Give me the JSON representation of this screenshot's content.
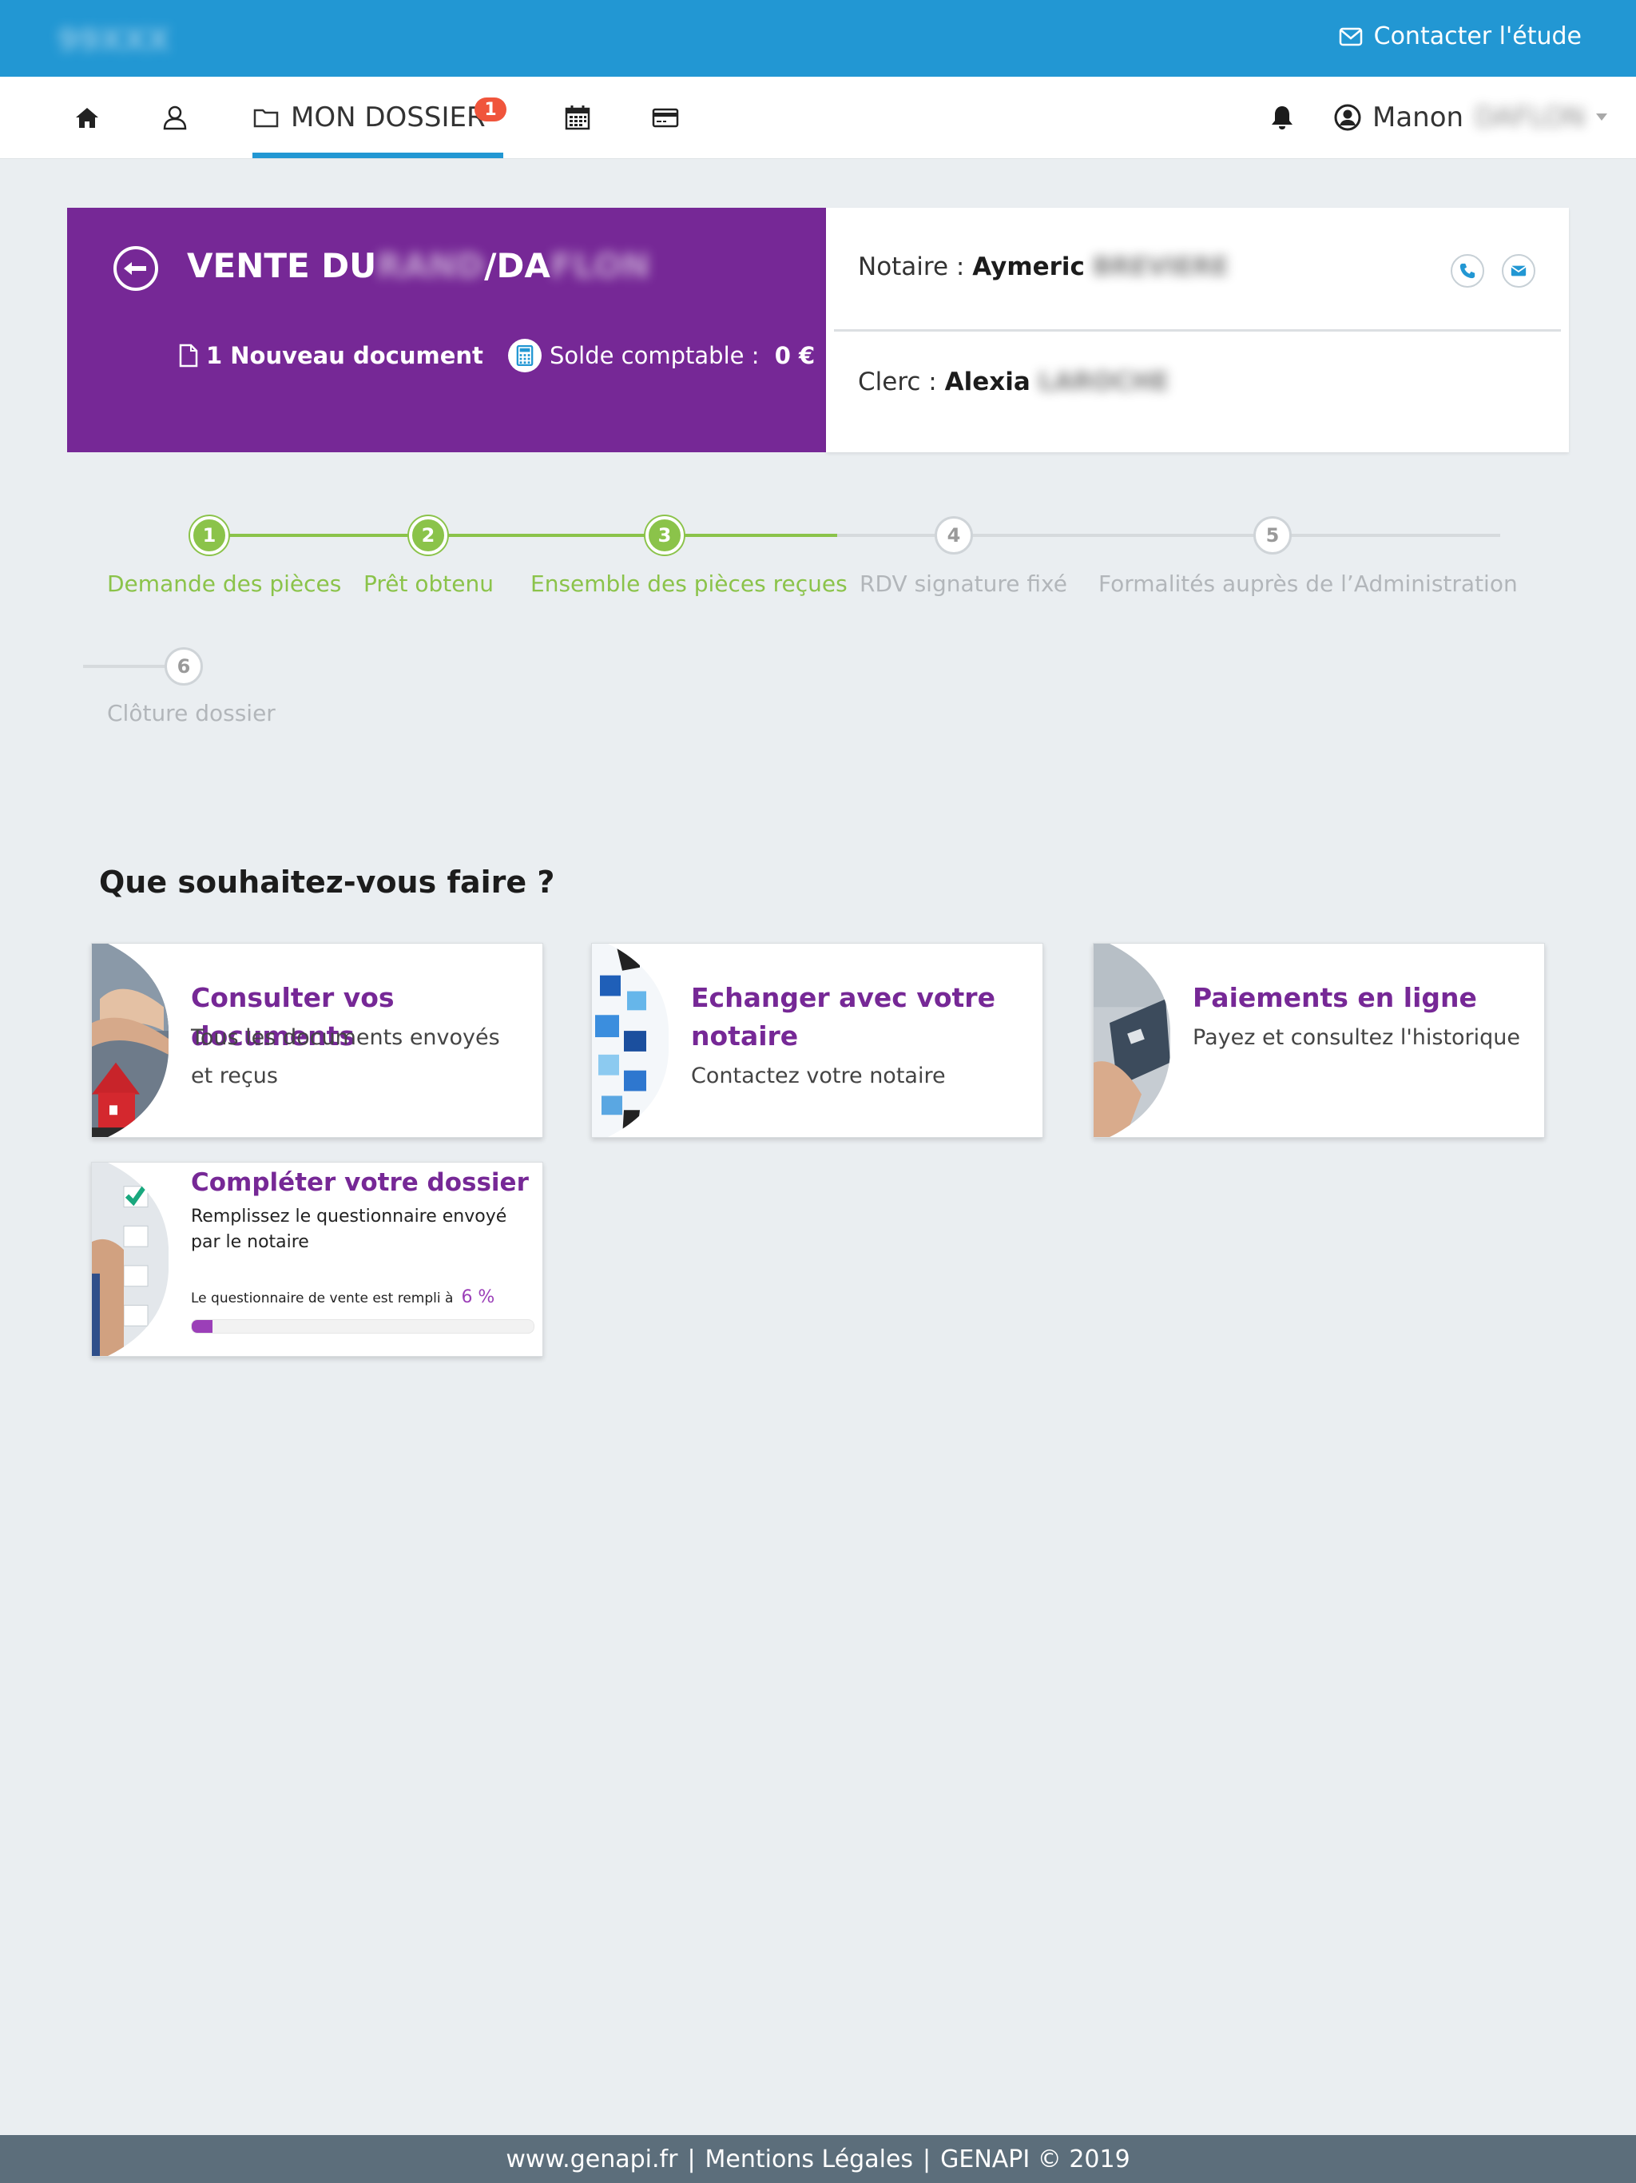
{
  "topbar": {
    "brand": "99XXX",
    "contact_label": "Contacter l'étude"
  },
  "nav": {
    "active_label": "MON DOSSIER",
    "badge_count": "1",
    "user_first": "Manon",
    "user_last": "DAFLON"
  },
  "dossier": {
    "title_prefix": "VENTE DU",
    "title_blur1": "RAND",
    "title_mid": "/DA",
    "title_blur2": "FLON",
    "new_doc": "1 Nouveau document",
    "solde_label": "Solde comptable : ",
    "solde_value": "0 €",
    "notaire_label": "Notaire : ",
    "notaire_first": "Aymeric",
    "notaire_last": "BREVIERE",
    "clerc_label": "Clerc : ",
    "clerc_first": "Alexia",
    "clerc_last": "LAROCHE"
  },
  "steps": [
    {
      "num": "1",
      "label": "Demande des pièces",
      "done": true
    },
    {
      "num": "2",
      "label": "Prêt obtenu",
      "done": true
    },
    {
      "num": "3",
      "label": "Ensemble des pièces reçues",
      "done": true
    },
    {
      "num": "4",
      "label": "RDV signature fixé",
      "done": false
    },
    {
      "num": "5",
      "label": "Formalités auprès de l’Administration",
      "done": false
    },
    {
      "num": "6",
      "label": "Clôture dossier",
      "done": false
    }
  ],
  "actions": {
    "title": "Que souhaitez-vous faire ?",
    "documents": {
      "title": "Consulter vos documents",
      "desc": "Tous les documents envoyés et reçus"
    },
    "echanger": {
      "title": "Echanger avec votre notaire",
      "desc": "Contactez votre notaire"
    },
    "paiements": {
      "title": "Paiements en ligne",
      "desc": "Payez et consultez l'historique"
    },
    "completer": {
      "title": "Compléter votre dossier",
      "desc": "Remplissez le questionnaire envoyé par le notaire",
      "progress_label": "Le questionnaire de vente est rempli à",
      "progress_text": "6 %",
      "progress_value": 0.06
    }
  },
  "footer": {
    "site": "www.genapi.fr",
    "sep1": "|",
    "mentions": "Mentions Légales",
    "sep2": "|",
    "copyright": "GENAPI © 2019"
  },
  "colors": {
    "topbar": "#2297d3",
    "dossier_purple": "#762896",
    "step_done": "#8bc34a",
    "step_todo": "#cfd4d8",
    "badge": "#f0553c",
    "footer": "#5c6e7b"
  }
}
